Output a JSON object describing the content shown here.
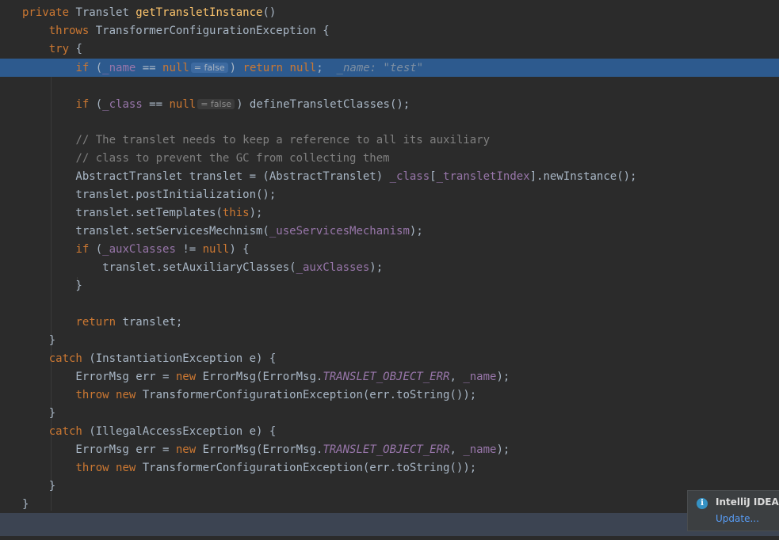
{
  "editor": {
    "language": "Java",
    "lines": [
      {
        "tokens": [
          {
            "t": "kw",
            "v": "private "
          },
          {
            "t": "plain",
            "v": "Translet "
          },
          {
            "t": "fn",
            "v": "getTransletInstance"
          },
          {
            "t": "plain",
            "v": "()"
          }
        ]
      },
      {
        "tokens": [
          {
            "t": "plain",
            "v": "    "
          },
          {
            "t": "kw",
            "v": "throws "
          },
          {
            "t": "plain",
            "v": "TransformerConfigurationException {"
          }
        ]
      },
      {
        "tokens": [
          {
            "t": "plain",
            "v": "    "
          },
          {
            "t": "kw",
            "v": "try "
          },
          {
            "t": "plain",
            "v": "{"
          }
        ]
      },
      {
        "highlight": true,
        "tokens": [
          {
            "t": "plain",
            "v": "        "
          },
          {
            "t": "kw",
            "v": "if "
          },
          {
            "t": "plain",
            "v": "("
          },
          {
            "t": "field",
            "v": "_name"
          },
          {
            "t": "plain",
            "v": " == "
          },
          {
            "t": "kw",
            "v": "null"
          },
          {
            "t": "inlay",
            "v": "= false"
          },
          {
            "t": "plain",
            "v": ") "
          },
          {
            "t": "kw",
            "v": "return null"
          },
          {
            "t": "plain",
            "v": ";  "
          },
          {
            "t": "debug",
            "v": "_name: \"test\""
          }
        ]
      },
      {
        "tokens": []
      },
      {
        "tokens": [
          {
            "t": "plain",
            "v": "        "
          },
          {
            "t": "kw",
            "v": "if "
          },
          {
            "t": "plain",
            "v": "("
          },
          {
            "t": "field",
            "v": "_class"
          },
          {
            "t": "plain",
            "v": " == "
          },
          {
            "t": "kw",
            "v": "null"
          },
          {
            "t": "inlay",
            "v": "= false"
          },
          {
            "t": "plain",
            "v": ") defineTransletClasses();"
          }
        ]
      },
      {
        "tokens": []
      },
      {
        "tokens": [
          {
            "t": "plain",
            "v": "        "
          },
          {
            "t": "com",
            "v": "// The translet needs to keep a reference to all its auxiliary"
          }
        ]
      },
      {
        "tokens": [
          {
            "t": "plain",
            "v": "        "
          },
          {
            "t": "com",
            "v": "// class to prevent the GC from collecting them"
          }
        ]
      },
      {
        "tokens": [
          {
            "t": "plain",
            "v": "        AbstractTranslet translet = (AbstractTranslet) "
          },
          {
            "t": "field",
            "v": "_class"
          },
          {
            "t": "plain",
            "v": "["
          },
          {
            "t": "field",
            "v": "_transletIndex"
          },
          {
            "t": "plain",
            "v": "].newInstance();"
          }
        ]
      },
      {
        "tokens": [
          {
            "t": "plain",
            "v": "        translet.postInitialization();"
          }
        ]
      },
      {
        "tokens": [
          {
            "t": "plain",
            "v": "        translet.setTemplates("
          },
          {
            "t": "kw",
            "v": "this"
          },
          {
            "t": "plain",
            "v": ");"
          }
        ]
      },
      {
        "tokens": [
          {
            "t": "plain",
            "v": "        translet.setServicesMechnism("
          },
          {
            "t": "field",
            "v": "_useServicesMechanism"
          },
          {
            "t": "plain",
            "v": ");"
          }
        ]
      },
      {
        "tokens": [
          {
            "t": "plain",
            "v": "        "
          },
          {
            "t": "kw",
            "v": "if "
          },
          {
            "t": "plain",
            "v": "("
          },
          {
            "t": "field",
            "v": "_auxClasses"
          },
          {
            "t": "plain",
            "v": " != "
          },
          {
            "t": "kw",
            "v": "null"
          },
          {
            "t": "plain",
            "v": ") {"
          }
        ]
      },
      {
        "tokens": [
          {
            "t": "plain",
            "v": "            translet.setAuxiliaryClasses("
          },
          {
            "t": "field",
            "v": "_auxClasses"
          },
          {
            "t": "plain",
            "v": ");"
          }
        ]
      },
      {
        "tokens": [
          {
            "t": "plain",
            "v": "        }"
          }
        ]
      },
      {
        "tokens": []
      },
      {
        "tokens": [
          {
            "t": "plain",
            "v": "        "
          },
          {
            "t": "kw",
            "v": "return "
          },
          {
            "t": "plain",
            "v": "translet;"
          }
        ]
      },
      {
        "tokens": [
          {
            "t": "plain",
            "v": "    }"
          }
        ]
      },
      {
        "tokens": [
          {
            "t": "plain",
            "v": "    "
          },
          {
            "t": "kw",
            "v": "catch "
          },
          {
            "t": "plain",
            "v": "(InstantiationException e) {"
          }
        ]
      },
      {
        "tokens": [
          {
            "t": "plain",
            "v": "        ErrorMsg err = "
          },
          {
            "t": "kw",
            "v": "new "
          },
          {
            "t": "plain",
            "v": "ErrorMsg(ErrorMsg."
          },
          {
            "t": "const",
            "v": "TRANSLET_OBJECT_ERR"
          },
          {
            "t": "plain",
            "v": ", "
          },
          {
            "t": "field",
            "v": "_name"
          },
          {
            "t": "plain",
            "v": ");"
          }
        ]
      },
      {
        "tokens": [
          {
            "t": "plain",
            "v": "        "
          },
          {
            "t": "kw",
            "v": "throw new "
          },
          {
            "t": "plain",
            "v": "TransformerConfigurationException(err.toString());"
          }
        ]
      },
      {
        "tokens": [
          {
            "t": "plain",
            "v": "    }"
          }
        ]
      },
      {
        "tokens": [
          {
            "t": "plain",
            "v": "    "
          },
          {
            "t": "kw",
            "v": "catch "
          },
          {
            "t": "plain",
            "v": "(IllegalAccessException e) {"
          }
        ]
      },
      {
        "tokens": [
          {
            "t": "plain",
            "v": "        ErrorMsg err = "
          },
          {
            "t": "kw",
            "v": "new "
          },
          {
            "t": "plain",
            "v": "ErrorMsg(ErrorMsg."
          },
          {
            "t": "const",
            "v": "TRANSLET_OBJECT_ERR"
          },
          {
            "t": "plain",
            "v": ", "
          },
          {
            "t": "field",
            "v": "_name"
          },
          {
            "t": "plain",
            "v": ");"
          }
        ]
      },
      {
        "tokens": [
          {
            "t": "plain",
            "v": "        "
          },
          {
            "t": "kw",
            "v": "throw new "
          },
          {
            "t": "plain",
            "v": "TransformerConfigurationException(err.toString());"
          }
        ]
      },
      {
        "tokens": [
          {
            "t": "plain",
            "v": "    }"
          }
        ]
      },
      {
        "tokens": [
          {
            "t": "plain",
            "v": "}"
          }
        ]
      }
    ]
  },
  "notification": {
    "title": "IntelliJ IDEA",
    "link": "Update..."
  },
  "colors": {
    "background": "#2b2b2b",
    "keyword": "#cc7832",
    "method": "#ffc66d",
    "field": "#9876aa",
    "comment": "#808080",
    "text": "#a9b7c6",
    "execution_line": "#2d5a8e"
  }
}
